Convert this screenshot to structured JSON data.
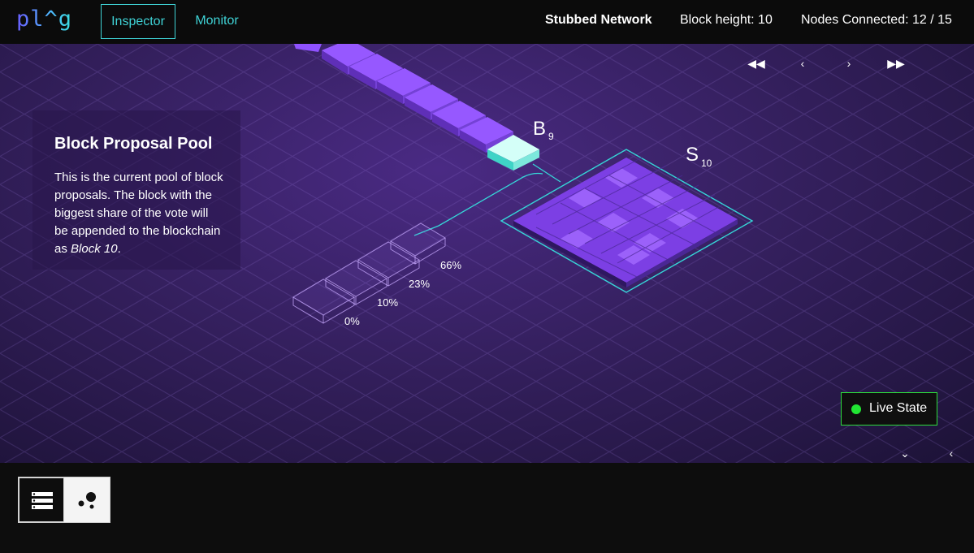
{
  "app": {
    "logo_text": "pl^g",
    "tabs": [
      {
        "label": "Inspector",
        "active": true
      },
      {
        "label": "Monitor",
        "active": false
      }
    ]
  },
  "status": {
    "network": "Stubbed Network",
    "block_height": "Block height: 10",
    "nodes_connected": "Nodes Connected: 12 / 15"
  },
  "playback": {
    "rewind_icon": "fast-rewind-icon",
    "prev_icon": "chevron-left-icon",
    "next_icon": "chevron-right-icon",
    "fastforward_icon": "fast-forward-icon"
  },
  "info_panel": {
    "title": "Block Proposal Pool",
    "body": "This is the current pool of block proposals. The block with the biggest share of the vote will be appended to the blockchain as ",
    "body_emphasis": "Block 10",
    "body_end": "."
  },
  "scene": {
    "block_label": "B",
    "block_subscript": "9",
    "state_label": "S",
    "state_subscript": "10",
    "proposals": [
      "0%",
      "10%",
      "23%",
      "66%"
    ],
    "colors": {
      "block": "#8f52ff",
      "highlight_block": "#c9fbf5",
      "accent_line": "#36d6d8"
    }
  },
  "live_state": {
    "label": "Live State",
    "color": "#21e633"
  },
  "corner_controls": {
    "down_icon": "chevron-down-icon",
    "left_icon": "chevron-left-icon"
  },
  "bottom": {
    "views": [
      "list-view-icon",
      "graph-view-icon"
    ]
  }
}
